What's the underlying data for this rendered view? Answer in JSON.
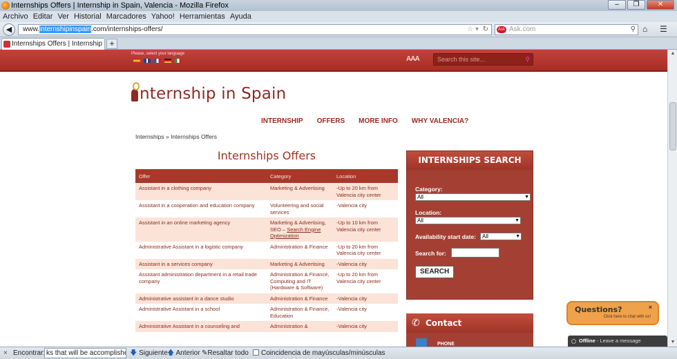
{
  "browser": {
    "window_title": "Internships Offers | Internship in Spain, Valencia - Mozilla Firefox",
    "menu": [
      "Archivo",
      "Editar",
      "Ver",
      "Historial",
      "Marcadores",
      "Yahoo!",
      "Herramientas",
      "Ayuda"
    ],
    "url_prefix": "www.",
    "url_highlight": "internshipinspain",
    "url_suffix": ".com/internships-offers/",
    "search_placeholder": "Ask.com",
    "tab_title": "Internships Offers | Internship in ...",
    "new_tab": "+"
  },
  "site": {
    "language_label": "Please, select your language",
    "flags": [
      "#e8c020",
      "#24408e",
      "#3355aa",
      "#cc2222",
      "#2a9a3a"
    ],
    "font_size_control": "AAA",
    "search_placeholder": "Search this site...",
    "logo_text": "nternship in Spain",
    "nav": [
      "INTERNSHIP",
      "OFFERS",
      "MORE INFO",
      "WHY VALENCIA?"
    ],
    "breadcrumb_home": "Internships",
    "breadcrumb_sep": "»",
    "breadcrumb_current": "Internships Offers",
    "page_title": "Internships Offers",
    "table": {
      "headers": [
        "Offer",
        "Category",
        "Location"
      ],
      "rows": [
        {
          "offer": "Assistant in a clothing company",
          "category": "Marketing & Advertising",
          "location": "-Up to 20 km from Valencia city center"
        },
        {
          "offer": "Assistant in a cooperation and education company",
          "category": "Volunteering and social services",
          "location": "-Valencia city"
        },
        {
          "offer": "Assistant in an online marketing agency",
          "category": "Marketing & Advertising, SEO –",
          "category_link": "Search Engine Optimization",
          "location": "-Up to 10 km from Valencia city center"
        },
        {
          "offer": "Administrative Assistant in a logistic company",
          "category": "Administration & Finance",
          "location": "-Up to 20 km from Valencia city center"
        },
        {
          "offer": "Assistant in a services company",
          "category": "Marketing & Advertising",
          "location": "-Valencia city"
        },
        {
          "offer": "Assistant administration department in a retail trade company",
          "category": "Administration & Finance, Computing and IT (Hardware & Software)",
          "location": "-Up to 20 km from Valencia city center"
        },
        {
          "offer": "Administrative assistant in a dance studio",
          "category": "Administration & Finance",
          "location": "-Valencia city"
        },
        {
          "offer": "Administrative Assistant in a school",
          "category": "Administration & Finance, Education",
          "location": "-Valencia city"
        },
        {
          "offer": "Administrative Assistant in a counseling and",
          "category": "Administration &",
          "location": "-Valencia city"
        }
      ]
    },
    "search_panel": {
      "title": "INTERNSHIPS SEARCH",
      "category_label": "Category:",
      "category_value": "All",
      "location_label": "Location:",
      "location_value": "All",
      "availability_label": "Availability start date:",
      "availability_value": "All",
      "search_for_label": "Search for:",
      "search_button": "SEARCH"
    },
    "contact": {
      "title": "Contact",
      "phone_label": "PHONE"
    },
    "chat": {
      "title": "Questions?",
      "subtitle": "Click here to chat with us!",
      "close": "×",
      "offline_status": "Offline",
      "offline_text": " - Leave a message"
    }
  },
  "findbar": {
    "close": "×",
    "label": "Encontrar:",
    "value": "ks that will be accomplished",
    "next": "Siguiente",
    "prev": "Anterior",
    "highlight": "Resaltar todo",
    "match_case": "Coincidencia de mayúsculas/minúsculas"
  }
}
